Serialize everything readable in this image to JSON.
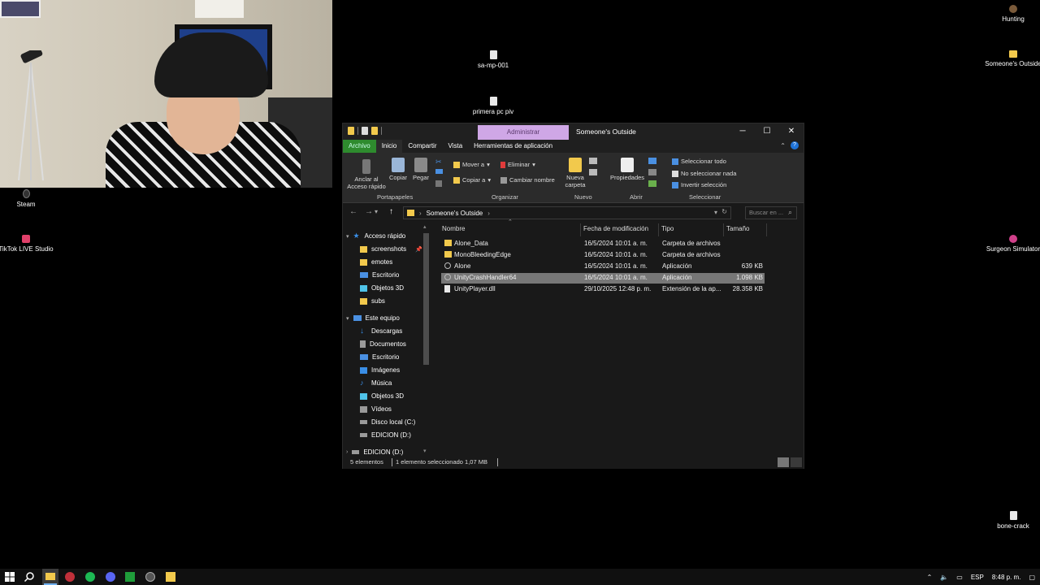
{
  "desktop_icons": [
    {
      "label": "sa-mp-001"
    },
    {
      "label": "primera pc piv"
    },
    {
      "label": "Hunting"
    },
    {
      "label": "Someone's Outside"
    },
    {
      "label": "Steam"
    },
    {
      "label": "TikTok LIVE Studio"
    },
    {
      "label": "Surgeon Simulator"
    },
    {
      "label": "bone-crack"
    }
  ],
  "window": {
    "title": "Someone's Outside",
    "context_tab": "Administrar",
    "controls": {
      "minimize": "─",
      "maximize": "☐",
      "close": "✕"
    }
  },
  "ribbon_tabs": [
    "Archivo",
    "Inicio",
    "Compartir",
    "Vista",
    "Herramientas de aplicación"
  ],
  "ribbon": {
    "portapapeles": {
      "label": "Portapapeles",
      "pin": "Anclar al Acceso rápido",
      "copy": "Copiar",
      "paste": "Pegar"
    },
    "organizar": {
      "label": "Organizar",
      "move": "Mover a",
      "copy_to": "Copiar a",
      "delete": "Eliminar",
      "rename": "Cambiar nombre"
    },
    "nuevo": {
      "label": "Nuevo",
      "new_folder": "Nueva carpeta"
    },
    "abrir": {
      "label": "Abrir",
      "properties": "Propiedades"
    },
    "seleccionar": {
      "label": "Seleccionar",
      "select_all": "Seleccionar todo",
      "select_none": "No seleccionar nada",
      "invert": "Invertir selección"
    }
  },
  "address": {
    "path": "Someone's Outside",
    "search_placeholder": "Buscar en ..."
  },
  "navpane": {
    "quick_access": "Acceso rápido",
    "quick_items": [
      "screenshots",
      "emotes",
      "Escritorio",
      "Objetos 3D",
      "subs"
    ],
    "this_pc": "Este equipo",
    "pc_items": [
      "Descargas",
      "Documentos",
      "Escritorio",
      "Imágenes",
      "Música",
      "Objetos 3D",
      "Vídeos",
      "Disco local (C:)",
      "EDICION (D:)"
    ],
    "drive": "EDICION (D:)"
  },
  "columns": {
    "name": "Nombre",
    "date": "Fecha de modificación",
    "type": "Tipo",
    "size": "Tamaño"
  },
  "files": [
    {
      "name": "Alone_Data",
      "date": "16/5/2024 10:01 a. m.",
      "type": "Carpeta de archivos",
      "size": "",
      "icon": "folder-icon"
    },
    {
      "name": "MonoBleedingEdge",
      "date": "16/5/2024 10:01 a. m.",
      "type": "Carpeta de archivos",
      "size": "",
      "icon": "folder-icon"
    },
    {
      "name": "Alone",
      "date": "16/5/2024 10:01 a. m.",
      "type": "Aplicación",
      "size": "639 KB",
      "icon": "app-icon"
    },
    {
      "name": "UnityCrashHandler64",
      "date": "16/5/2024 10:01 a. m.",
      "type": "Aplicación",
      "size": "1.098 KB",
      "icon": "app-icon"
    },
    {
      "name": "UnityPlayer.dll",
      "date": "29/10/2025 12:48 p. m.",
      "type": "Extensión de la ap...",
      "size": "28.358 KB",
      "icon": "dll-icon"
    }
  ],
  "status": {
    "count": "5 elementos",
    "selection": "1 elemento seleccionado 1,07 MB"
  },
  "taskbar": {
    "lang": "ESP",
    "time": "8:48 p. m."
  }
}
